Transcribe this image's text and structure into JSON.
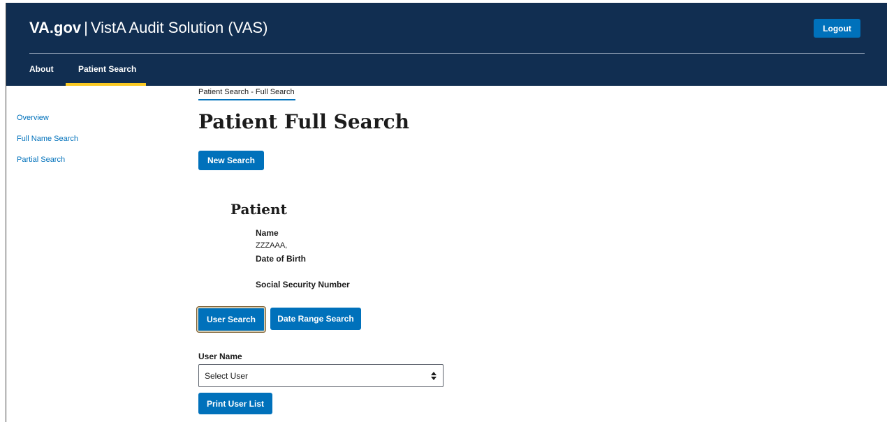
{
  "header": {
    "brand_bold": "VA.gov",
    "brand_separator": "|",
    "brand_rest": "VistA Audit Solution (VAS)",
    "logout_label": "Logout"
  },
  "nav": {
    "items": [
      "About",
      "Patient Search"
    ],
    "active": "Patient Search"
  },
  "sidebar": {
    "items": [
      "Overview",
      "Full Name Search",
      "Partial Search"
    ]
  },
  "breadcrumb": "Patient Search - Full Search",
  "page_title": "Patient Full Search",
  "new_search_label": "New Search",
  "patient": {
    "section_title": "Patient",
    "name_label": "Name",
    "name_value": "ZZZAAA,",
    "dob_label": "Date of Birth",
    "dob_value": "",
    "ssn_label": "Social Security Number",
    "ssn_value": ""
  },
  "search_mode": {
    "user_search_label": "User Search",
    "date_range_label": "Date Range Search",
    "selected": "User Search"
  },
  "user_name": {
    "label": "User Name",
    "selected": "Select User"
  },
  "print_label": "Print User List",
  "colors": {
    "header_bg": "#112e51",
    "primary": "#0071bb",
    "active_underline": "#fac922"
  },
  "icons": {
    "select_arrow": "sort-arrows-icon"
  }
}
